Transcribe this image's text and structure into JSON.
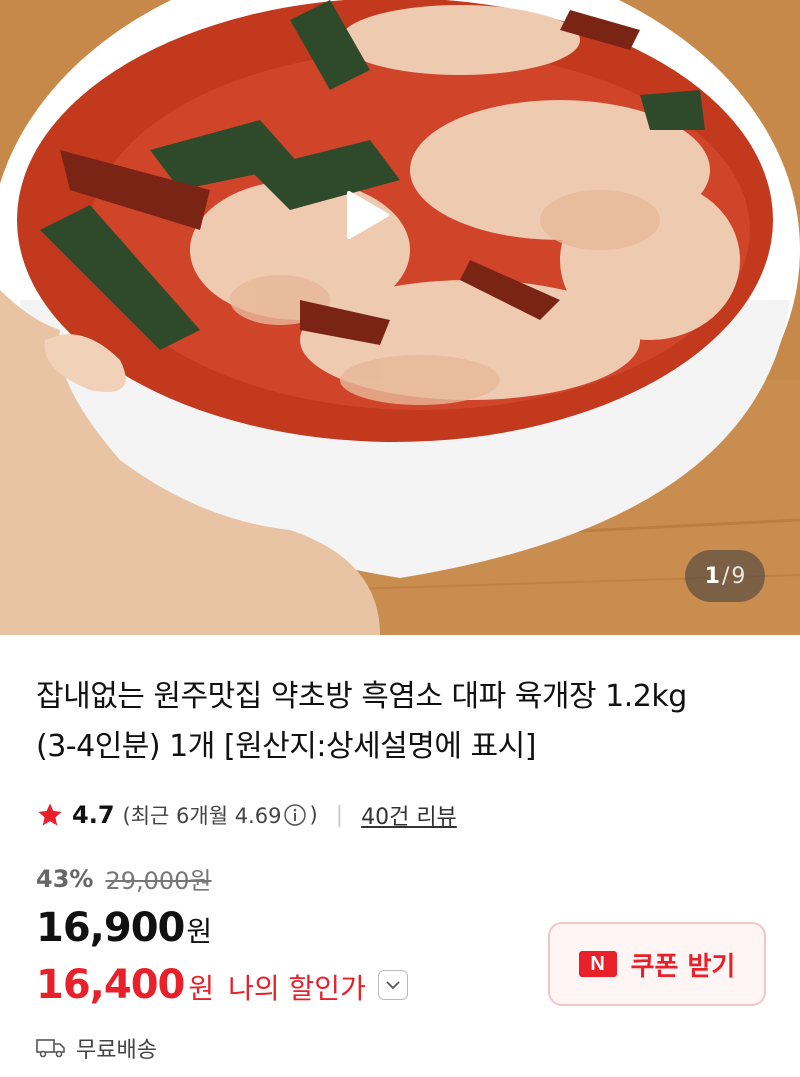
{
  "gallery": {
    "current": "1",
    "separator": "/",
    "total": "9",
    "image_alt": "product-photo"
  },
  "product": {
    "title_line1": "잡내없는 원주맛집 약초방 흑염소 대파 육개장 1.2kg",
    "title_line2": "(3-4인분) 1개 [원산지:상세설명에 표시]"
  },
  "rating": {
    "score": "4.7",
    "recent_open": "(최근 6개월 4.69",
    "recent_close": ")",
    "separator": "|",
    "reviews_link": "40건 리뷰"
  },
  "pricing": {
    "discount_percent": "43%",
    "original_price": "29,000원",
    "sale_price": "16,900",
    "sale_currency": "원",
    "my_price": "16,400",
    "my_currency": "원",
    "my_price_label": "나의 할인가"
  },
  "coupon": {
    "logo_text": "N",
    "label": "쿠폰 받기"
  },
  "shipping": {
    "label": "무료배송"
  },
  "colors": {
    "accent_red": "#e8202a",
    "star": "#e8202a",
    "coupon_bg": "#fff5f5",
    "coupon_border": "#f2c6c6"
  },
  "icons": {
    "play": "play-icon",
    "star": "star-icon",
    "info": "info-icon",
    "chevron": "chevron-down-icon",
    "truck": "truck-icon",
    "naver_pay": "naver-n-logo"
  }
}
